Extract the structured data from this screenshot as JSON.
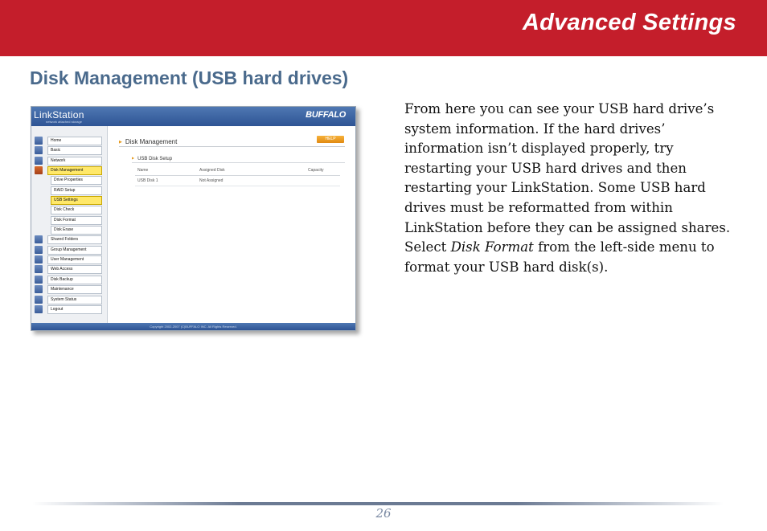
{
  "banner": {
    "title": "Advanced Settings",
    "color": "#c41e2b"
  },
  "section": {
    "heading": "Disk Management (USB hard drives)"
  },
  "screenshot": {
    "app_name": "LinkStation",
    "app_tagline": "network attached storage",
    "brand": "BUFFALO",
    "nav_items": [
      {
        "label": "Home",
        "sub": false,
        "active": false
      },
      {
        "label": "Basic",
        "sub": false,
        "active": false
      },
      {
        "label": "Network",
        "sub": false,
        "active": false
      },
      {
        "label": "Disk Management",
        "sub": false,
        "active": true
      },
      {
        "label": "Drive Properties",
        "sub": true,
        "active": false
      },
      {
        "label": "RAID Setup",
        "sub": true,
        "active": false
      },
      {
        "label": "USB Settings",
        "sub": true,
        "active": true
      },
      {
        "label": "Disk Check",
        "sub": true,
        "active": false
      },
      {
        "label": "Disk Format",
        "sub": true,
        "active": false
      },
      {
        "label": "Disk Erase",
        "sub": true,
        "active": false
      },
      {
        "label": "Shared Folders",
        "sub": false,
        "active": false
      },
      {
        "label": "Group Management",
        "sub": false,
        "active": false
      },
      {
        "label": "User Management",
        "sub": false,
        "active": false
      },
      {
        "label": "Web Access",
        "sub": false,
        "active": false
      },
      {
        "label": "Disk Backup",
        "sub": false,
        "active": false
      },
      {
        "label": "Maintenance",
        "sub": false,
        "active": false
      },
      {
        "label": "System Status",
        "sub": false,
        "active": false
      },
      {
        "label": "Logout",
        "sub": false,
        "active": false
      }
    ],
    "main_title": "Disk Management",
    "help_label": "HELP",
    "subsection_title": "USB Disk Setup",
    "table_headers": [
      "Name",
      "Assigned Disk",
      "Capacity"
    ],
    "table_rows": [
      [
        "USB Disk 1",
        "Not Assigned",
        ""
      ]
    ],
    "copyright": "Copyright 2002-2007 (C)BUFFALO INC. All Rights Reserved."
  },
  "body": {
    "paragraph_before": "From here you can see your USB hard drive’s system information.  If the hard drives’ information isn’t displayed properly, try restarting your USB hard drives and then restarting your LinkStation.  Some USB hard drives must be reformatted from within LinkStation before they can be assigned shares.  Select ",
    "paragraph_emphasis": "Disk Format",
    "paragraph_after": " from the left-side menu to format your USB hard disk(s)."
  },
  "page_number": "26"
}
